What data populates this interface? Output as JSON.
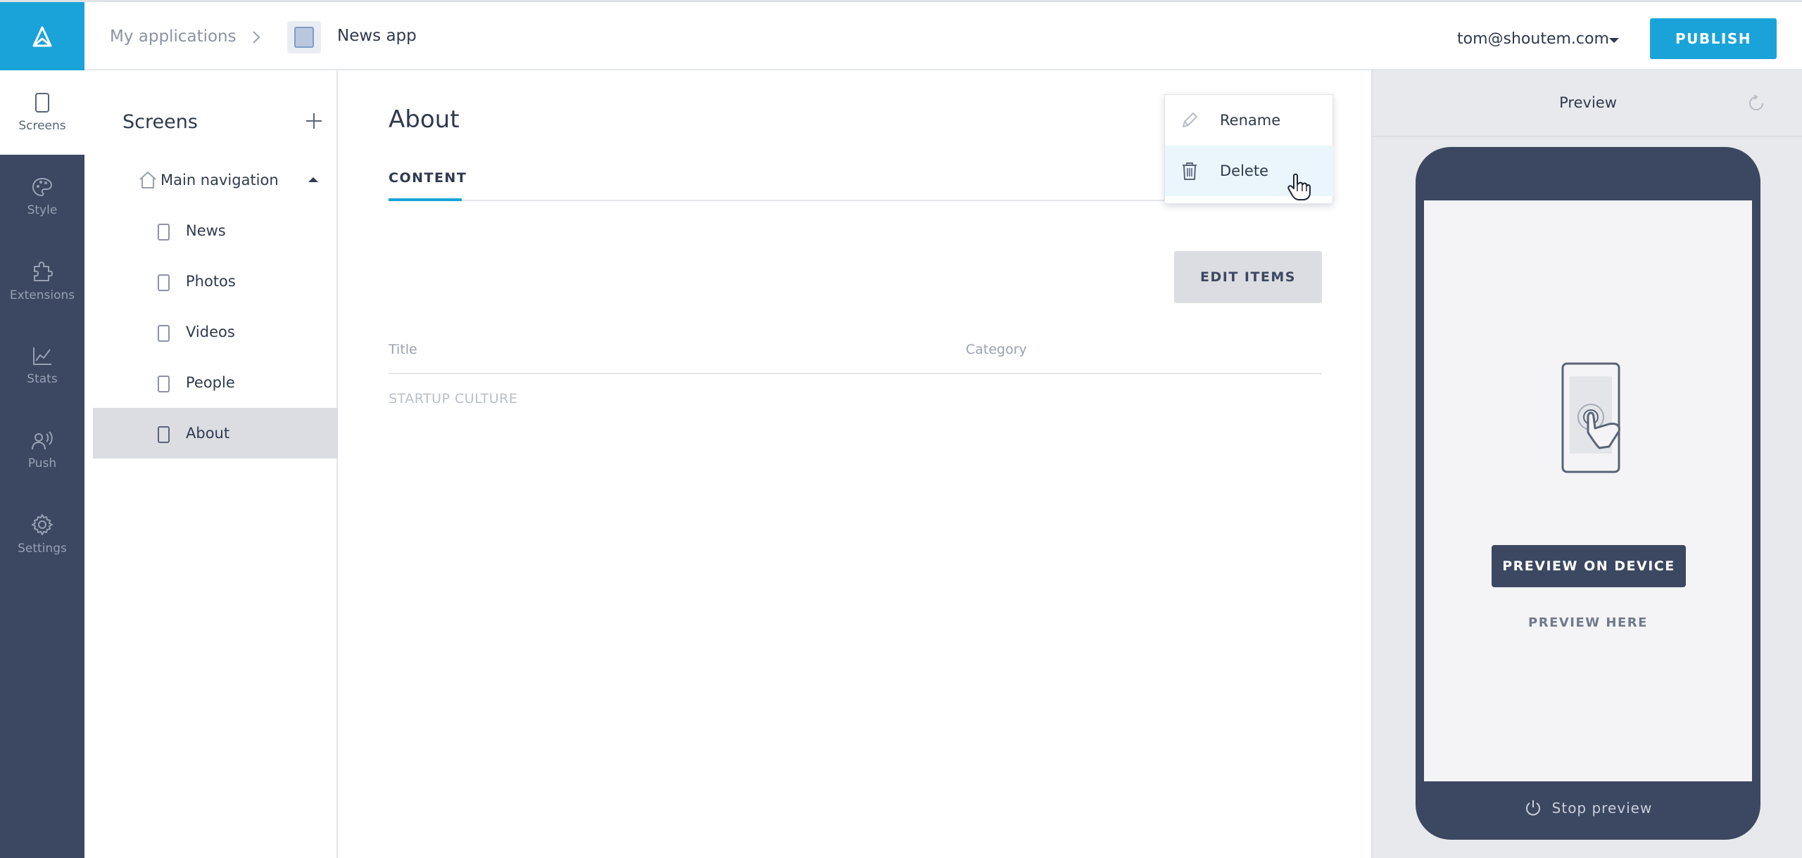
{
  "header": {
    "breadcrumb_root": "My applications",
    "app_name": "News app",
    "user_email": "tom@shoutem.com",
    "publish_label": "PUBLISH",
    "accent_color": "#1aa3d9"
  },
  "rail": {
    "items": [
      {
        "label": "Screens",
        "icon": "phone-icon",
        "active": true
      },
      {
        "label": "Style",
        "icon": "palette-icon"
      },
      {
        "label": "Extensions",
        "icon": "puzzle-icon"
      },
      {
        "label": "Stats",
        "icon": "chart-icon"
      },
      {
        "label": "Push",
        "icon": "broadcast-icon"
      },
      {
        "label": "Settings",
        "icon": "gear-icon"
      }
    ]
  },
  "screens": {
    "title": "Screens",
    "nav_group": "Main navigation",
    "items": [
      "News",
      "Photos",
      "Videos",
      "People",
      "About"
    ],
    "selected": "About"
  },
  "main": {
    "title": "About",
    "tab": "CONTENT",
    "edit_items_label": "EDIT ITEMS",
    "columns": [
      "Title",
      "Category"
    ],
    "rows": [
      {
        "title": "STARTUP CULTURE",
        "category": ""
      }
    ]
  },
  "dropdown": {
    "items": [
      {
        "label": "Rename",
        "icon": "pencil-icon"
      },
      {
        "label": "Delete",
        "icon": "trash-icon"
      }
    ]
  },
  "preview": {
    "label": "Preview",
    "device_button": "PREVIEW ON DEVICE",
    "preview_here": "PREVIEW HERE",
    "stop_label": "Stop preview"
  }
}
